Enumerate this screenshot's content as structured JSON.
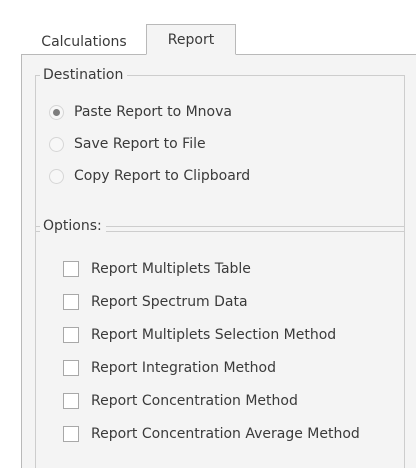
{
  "tabs": [
    {
      "label": "Calculations",
      "active": false
    },
    {
      "label": "Report",
      "active": true
    }
  ],
  "destination": {
    "title": "Destination",
    "options": [
      {
        "label": "Paste Report to Mnova",
        "selected": true
      },
      {
        "label": "Save Report to File",
        "selected": false
      },
      {
        "label": "Copy Report to Clipboard",
        "selected": false
      }
    ]
  },
  "options": {
    "title": "Options:",
    "items": [
      {
        "label": "Report Multiplets Table",
        "checked": false
      },
      {
        "label": "Report Spectrum Data",
        "checked": false
      },
      {
        "label": "Report Multiplets Selection Method",
        "checked": false
      },
      {
        "label": "Report Integration Method",
        "checked": false
      },
      {
        "label": "Report Concentration Method",
        "checked": false
      },
      {
        "label": "Report Concentration Average Method",
        "checked": false
      }
    ]
  }
}
